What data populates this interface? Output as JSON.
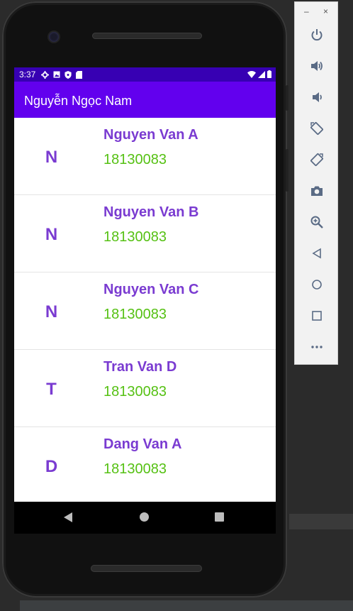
{
  "device": {
    "status_time": "3:37"
  },
  "app_bar": {
    "title": "Nguyễn Ngọc Nam"
  },
  "list": {
    "items": [
      {
        "initial": "N",
        "name": "Nguyen Van A",
        "code": "18130083"
      },
      {
        "initial": "N",
        "name": "Nguyen Van B",
        "code": "18130083"
      },
      {
        "initial": "N",
        "name": "Nguyen Van C",
        "code": "18130083"
      },
      {
        "initial": "T",
        "name": "Tran Van D",
        "code": "18130083"
      },
      {
        "initial": "D",
        "name": "Dang Van A",
        "code": "18130083"
      }
    ]
  },
  "emulator_toolbar": {
    "minimize_label": "–",
    "close_label": "×",
    "buttons": [
      "power-icon",
      "volume-up-icon",
      "volume-down-icon",
      "rotate-left-icon",
      "rotate-right-icon",
      "camera-icon",
      "zoom-icon",
      "back-icon",
      "home-icon",
      "overview-icon",
      "more-icon"
    ]
  },
  "colors": {
    "status_bar": "#3700b3",
    "app_bar": "#6200ee",
    "name_text": "#7a3bd1",
    "code_text": "#56c114"
  }
}
